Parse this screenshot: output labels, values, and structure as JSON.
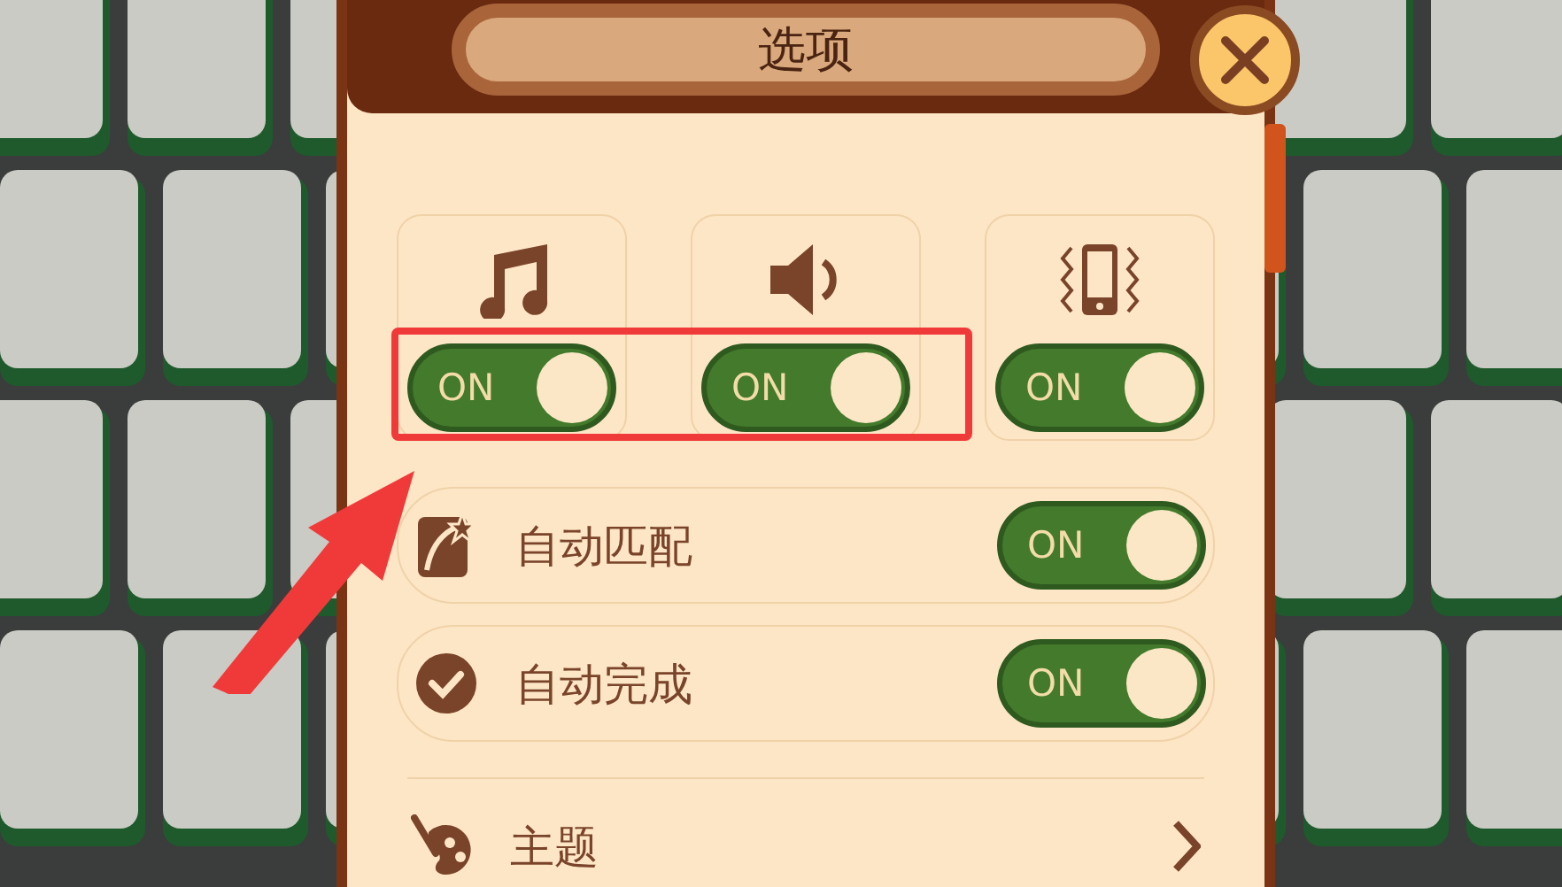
{
  "dialog": {
    "title": "选项"
  },
  "top_toggles": [
    {
      "switch_text": "ON",
      "on": true
    },
    {
      "switch_text": "ON",
      "on": true
    },
    {
      "switch_text": "ON",
      "on": true
    }
  ],
  "rows": [
    {
      "kind": "toggle",
      "label": "自动匹配",
      "switch_text": "ON",
      "on": true
    },
    {
      "kind": "toggle",
      "label": "自动完成",
      "switch_text": "ON",
      "on": true
    },
    {
      "kind": "link",
      "label": "主题"
    }
  ]
}
